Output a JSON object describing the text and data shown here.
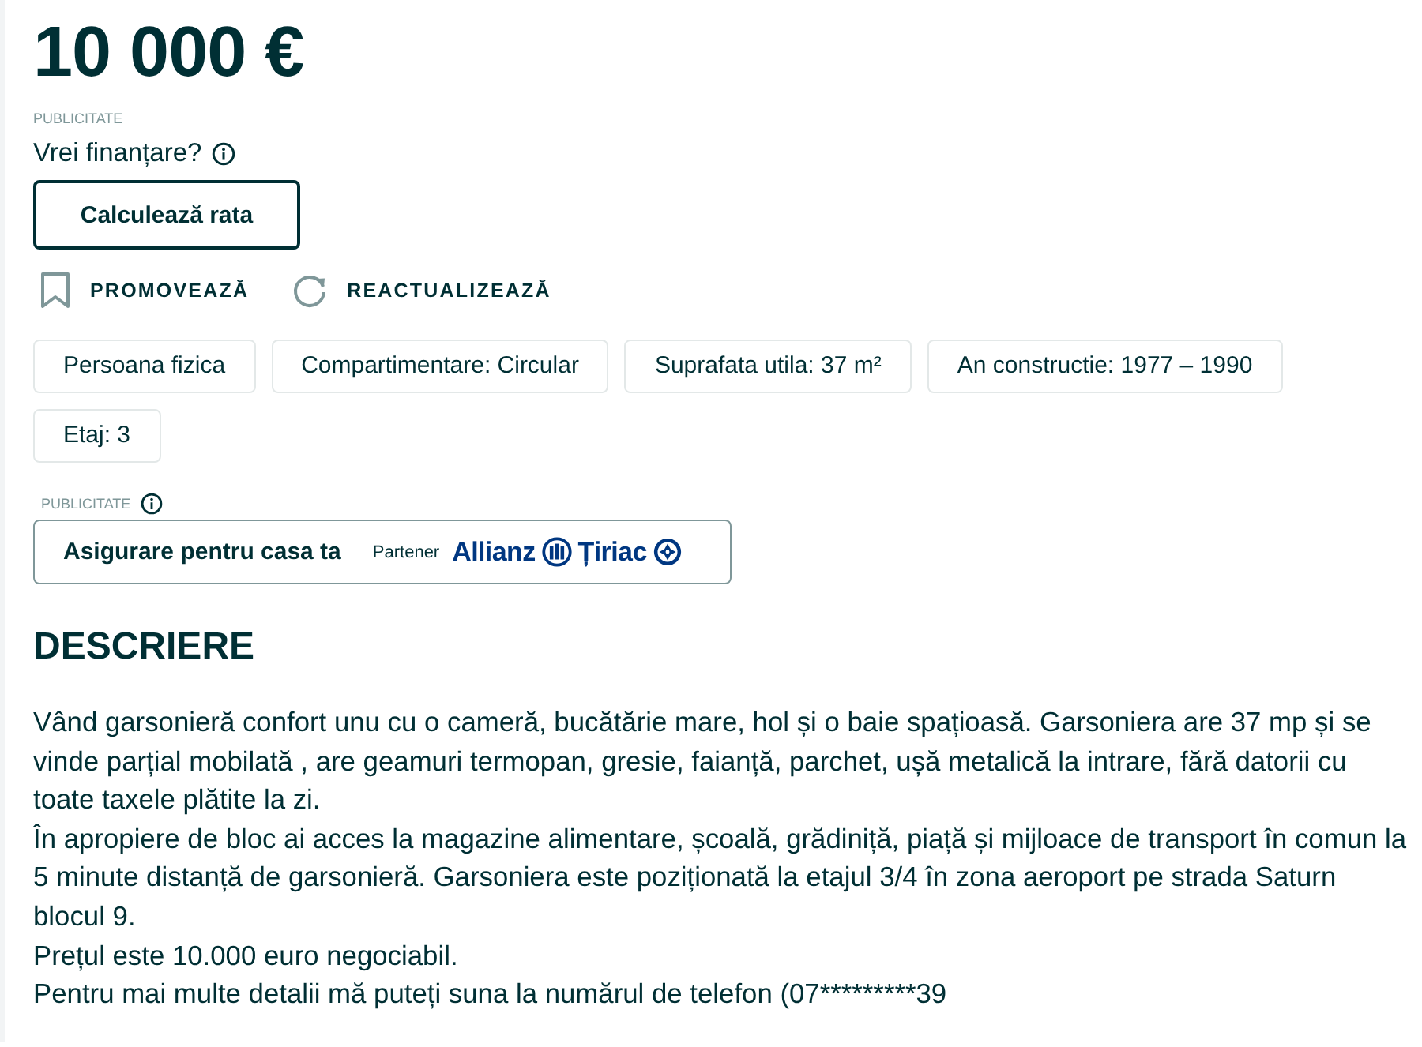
{
  "price": "10 000 €",
  "financing": {
    "ad_label": "PUBLICITATE",
    "question": "Vrei finanțare?",
    "button": "Calculează rata"
  },
  "actions": [
    {
      "kind": "promote",
      "label": "PROMOVEAZĂ"
    },
    {
      "kind": "refresh",
      "label": "REACTUALIZEAZĂ"
    }
  ],
  "tags": [
    "Persoana fizica",
    "Compartimentare: Circular",
    "Suprafata utila: 37 m²",
    "An constructie: 1977 – 1990",
    "Etaj: 3"
  ],
  "insurance_ad": {
    "ad_label": "PUBLICITATE",
    "title": "Asigurare pentru casa ta",
    "partner_label": "Partener",
    "partners": [
      {
        "kind": "bars",
        "name": "Allianz"
      },
      {
        "kind": "cross",
        "name": "Țiriac"
      }
    ]
  },
  "description": {
    "heading": "DESCRIERE",
    "paragraphs": [
      "Vând garsonieră confort unu cu o cameră, bucătărie mare, hol și o baie spațioasă. Garsoniera are 37 mp și se vinde parțial mobilată , are geamuri termopan, gresie, faianță, parchet, ușă metalică la intrare, fără datorii cu toate taxele plătite la zi.",
      "În apropiere de bloc ai acces la magazine alimentare, școală, grădiniță, piață și mijloace de transport în comun la 5 minute distanță de garsonieră. Garsoniera este poziționată la etajul 3/4 în zona aeroport pe strada Saturn blocul 9.",
      "Prețul este 10.000 euro negociabil.",
      "Pentru mai multe detalii mă puteți suna la numărul de telefon (07*********39"
    ]
  }
}
